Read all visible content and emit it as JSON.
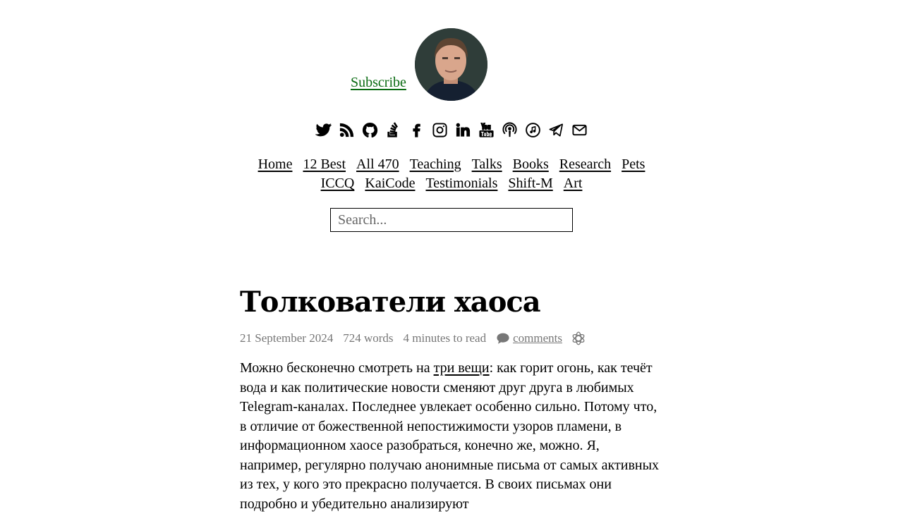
{
  "header": {
    "subscribe_label": "Subscribe",
    "avatar_alt": "author portrait"
  },
  "social_icons": [
    "twitter-icon",
    "rss-icon",
    "github-icon",
    "stackoverflow-icon",
    "facebook-icon",
    "instagram-icon",
    "linkedin-icon",
    "youtube-icon",
    "podcast-icon",
    "music-icon",
    "telegram-icon",
    "email-icon"
  ],
  "nav": {
    "row1": [
      "Home",
      "12 Best",
      "All 470",
      "Teaching",
      "Talks",
      "Books",
      "Research",
      "Pets"
    ],
    "row2": [
      "ICCQ",
      "KaiCode",
      "Testimonials",
      "Shift-M",
      "Art"
    ]
  },
  "search": {
    "placeholder": "Search..."
  },
  "article": {
    "title": "Толкователи хаоса",
    "date": "21 September 2024",
    "words": "724 words",
    "read_time": "4 minutes to read",
    "comments_label": "comments",
    "body_before_link": "Можно бесконечно смотреть на ",
    "body_link": "три вещи",
    "body_after_link": ": как горит огонь, как течёт вода и как политические новости сменяют друг друга в любимых Telegram-каналах. Последнее увлекает особенно сильно. Потому что, в отличие от божественной непостижимости узоров пламени, в информационном хаосе разобраться, конечно же, можно. Я, например, регулярно получаю анонимные письма от самых активных из тех, у кого это прекрасно получается. В своих письмах они подробно и убедительно анализируют"
  },
  "colors": {
    "subscribe": "#0a6b12",
    "meta": "#777777"
  }
}
